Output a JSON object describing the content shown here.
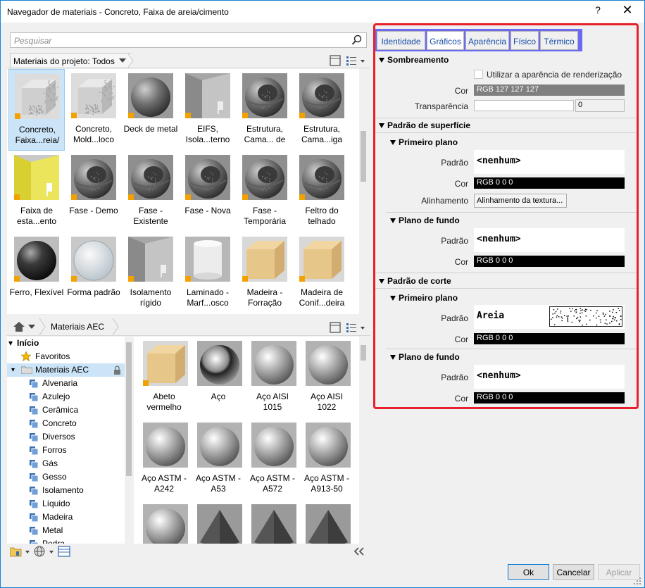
{
  "window": {
    "title": "Navegador de materiais - Concreto, Faixa de areia/cimento",
    "help_label": "?",
    "close_label": "✕"
  },
  "search": {
    "placeholder": "Pesquisar"
  },
  "project_filter": {
    "label": "Materiais do projeto: Todos"
  },
  "project_materials": [
    {
      "label": "Concreto, Faixa...reia/",
      "kind": "concrete"
    },
    {
      "label": "Concreto, Mold...loco",
      "kind": "concrete"
    },
    {
      "label": "Deck de metal",
      "kind": "sphere-dark"
    },
    {
      "label": "EIFS, Isola...terno",
      "kind": "wall"
    },
    {
      "label": "Estrutura, Cama... de",
      "kind": "sphere-mesh"
    },
    {
      "label": "Estrutura, Cama...iga",
      "kind": "sphere-mesh"
    },
    {
      "label": "Faixa de esta...ento",
      "kind": "yellow-wall"
    },
    {
      "label": "Fase - Demo",
      "kind": "sphere-mesh"
    },
    {
      "label": "Fase - Existente",
      "kind": "sphere-mesh"
    },
    {
      "label": "Fase - Nova",
      "kind": "sphere-mesh"
    },
    {
      "label": "Fase - Temporária",
      "kind": "sphere-mesh"
    },
    {
      "label": "Feltro do telhado",
      "kind": "sphere-mesh"
    },
    {
      "label": "Ferro, Flexível",
      "kind": "sphere-black"
    },
    {
      "label": "Forma padrão",
      "kind": "sphere-glass"
    },
    {
      "label": "Isolamento rígido",
      "kind": "wall"
    },
    {
      "label": "Laminado - Marf...osco",
      "kind": "cylinder"
    },
    {
      "label": "Madeira - Forração",
      "kind": "wood"
    },
    {
      "label": "Madeira de Conif...deira",
      "kind": "wood"
    }
  ],
  "library_nav": {
    "label": "Materiais AEC"
  },
  "tree": {
    "root": "Início",
    "favorites": "Favoritos",
    "library": "Materiais AEC",
    "categories": [
      "Alvenaria",
      "Azulejo",
      "Cerâmica",
      "Concreto",
      "Diversos",
      "Forros",
      "Gás",
      "Gesso",
      "Isolamento",
      "Líquido",
      "Madeira",
      "Metal",
      "Pedra"
    ]
  },
  "library_materials": [
    {
      "label": "Abeto vermelho",
      "kind": "wood"
    },
    {
      "label": "Aço",
      "kind": "sphere-chrome"
    },
    {
      "label": "Aço AISI 1015",
      "kind": "sphere-metal"
    },
    {
      "label": "Aço AISI 1022",
      "kind": "sphere-metal"
    },
    {
      "label": "Aço ASTM - A242",
      "kind": "sphere-metal"
    },
    {
      "label": "Aço ASTM - A53",
      "kind": "sphere-metal"
    },
    {
      "label": "Aço ASTM - A572",
      "kind": "sphere-metal"
    },
    {
      "label": "Aço ASTM - A913-50",
      "kind": "sphere-metal"
    },
    {
      "label": "",
      "kind": "sphere-metal"
    },
    {
      "label": "",
      "kind": "cone-dark"
    },
    {
      "label": "",
      "kind": "cone-dark"
    },
    {
      "label": "",
      "kind": "cone-dark"
    }
  ],
  "tabs": [
    "Identidade",
    "Gráficos",
    "Aparência",
    "Físico",
    "Térmico"
  ],
  "active_tab": "Gráficos",
  "shading": {
    "title": "Sombreamento",
    "use_render_label": "Utilizar a aparência de renderização",
    "color_label": "Cor",
    "color_value": "RGB 127 127 127",
    "transparency_label": "Transparência",
    "transparency_value": "0"
  },
  "surface_pattern": {
    "title": "Padrão de superfície",
    "foreground": {
      "title": "Primeiro plano",
      "pattern_label": "Padrão",
      "pattern_value": "<nenhum>",
      "color_label": "Cor",
      "color_value": "RGB 0 0 0",
      "align_label": "Alinhamento",
      "align_button": "Alinhamento da textura..."
    },
    "background": {
      "title": "Plano de fundo",
      "pattern_label": "Padrão",
      "pattern_value": "<nenhum>",
      "color_label": "Cor",
      "color_value": "RGB 0 0 0"
    }
  },
  "cut_pattern": {
    "title": "Padrão de corte",
    "foreground": {
      "title": "Primeiro plano",
      "pattern_label": "Padrão",
      "pattern_value": "Areia",
      "color_label": "Cor",
      "color_value": "RGB 0 0 0"
    },
    "background": {
      "title": "Plano de fundo",
      "pattern_label": "Padrão",
      "pattern_value": "<nenhum>",
      "color_label": "Cor",
      "color_value": "RGB 0 0 0"
    }
  },
  "buttons": {
    "ok": "Ok",
    "cancel": "Cancelar",
    "apply": "Aplicar"
  },
  "colors": {
    "accent_blue": "#6b6bf2",
    "highlight_red": "#e8202a",
    "selection": "#cce4f7"
  }
}
